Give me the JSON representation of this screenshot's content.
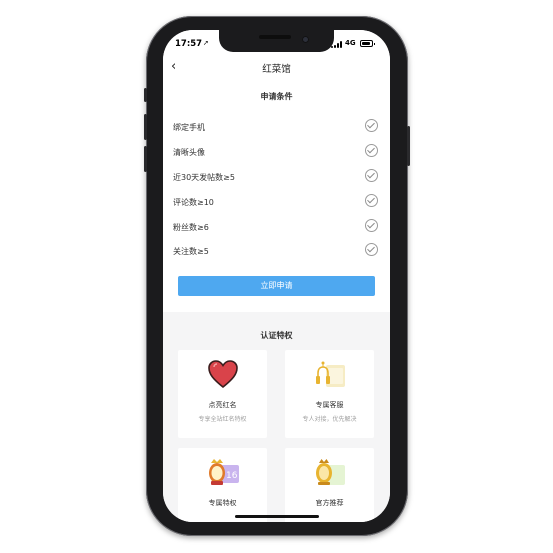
{
  "status": {
    "time": "17:57",
    "location_arrow": "➚",
    "network": "4G"
  },
  "navbar": {
    "back_glyph": "‹",
    "title": "红菜馆"
  },
  "conditions": {
    "title": "申请条件",
    "items": [
      {
        "label": "绑定手机",
        "met": true
      },
      {
        "label": "清晰头像",
        "met": true
      },
      {
        "label": "近30天发帖数≥5",
        "met": true
      },
      {
        "label": "评论数≥10",
        "met": true
      },
      {
        "label": "粉丝数≥6",
        "met": true
      },
      {
        "label": "关注数≥5",
        "met": true
      }
    ],
    "apply_label": "立即申请"
  },
  "privileges": {
    "title": "认证特权",
    "items": [
      {
        "name": "点亮红名",
        "desc": "专享全站红名特权",
        "icon": "heart-icon"
      },
      {
        "name": "专属客服",
        "desc": "专人对接，优先解决",
        "icon": "headset-icon"
      },
      {
        "name": "专属特权",
        "desc": "",
        "icon": "crown-badge-icon"
      },
      {
        "name": "官方推荐",
        "desc": "",
        "icon": "recommend-icon"
      }
    ]
  },
  "colors": {
    "accent": "#4ea8f0",
    "heart": "#d9434a",
    "gold": "#e8b430"
  }
}
